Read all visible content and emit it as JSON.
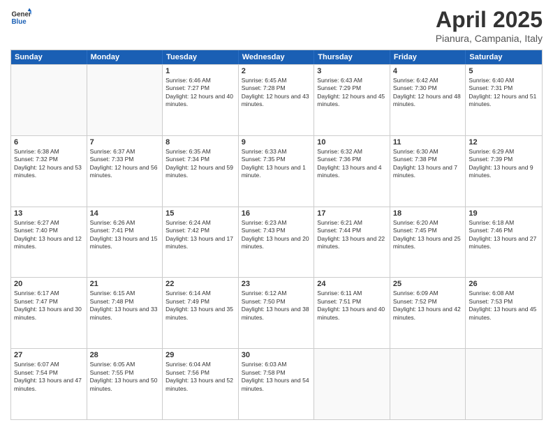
{
  "header": {
    "logo_line1": "General",
    "logo_line2": "Blue",
    "title": "April 2025",
    "subtitle": "Pianura, Campania, Italy"
  },
  "calendar": {
    "days": [
      "Sunday",
      "Monday",
      "Tuesday",
      "Wednesday",
      "Thursday",
      "Friday",
      "Saturday"
    ],
    "rows": [
      [
        {
          "day": "",
          "info": ""
        },
        {
          "day": "",
          "info": ""
        },
        {
          "day": "1",
          "info": "Sunrise: 6:46 AM\nSunset: 7:27 PM\nDaylight: 12 hours and 40 minutes."
        },
        {
          "day": "2",
          "info": "Sunrise: 6:45 AM\nSunset: 7:28 PM\nDaylight: 12 hours and 43 minutes."
        },
        {
          "day": "3",
          "info": "Sunrise: 6:43 AM\nSunset: 7:29 PM\nDaylight: 12 hours and 45 minutes."
        },
        {
          "day": "4",
          "info": "Sunrise: 6:42 AM\nSunset: 7:30 PM\nDaylight: 12 hours and 48 minutes."
        },
        {
          "day": "5",
          "info": "Sunrise: 6:40 AM\nSunset: 7:31 PM\nDaylight: 12 hours and 51 minutes."
        }
      ],
      [
        {
          "day": "6",
          "info": "Sunrise: 6:38 AM\nSunset: 7:32 PM\nDaylight: 12 hours and 53 minutes."
        },
        {
          "day": "7",
          "info": "Sunrise: 6:37 AM\nSunset: 7:33 PM\nDaylight: 12 hours and 56 minutes."
        },
        {
          "day": "8",
          "info": "Sunrise: 6:35 AM\nSunset: 7:34 PM\nDaylight: 12 hours and 59 minutes."
        },
        {
          "day": "9",
          "info": "Sunrise: 6:33 AM\nSunset: 7:35 PM\nDaylight: 13 hours and 1 minute."
        },
        {
          "day": "10",
          "info": "Sunrise: 6:32 AM\nSunset: 7:36 PM\nDaylight: 13 hours and 4 minutes."
        },
        {
          "day": "11",
          "info": "Sunrise: 6:30 AM\nSunset: 7:38 PM\nDaylight: 13 hours and 7 minutes."
        },
        {
          "day": "12",
          "info": "Sunrise: 6:29 AM\nSunset: 7:39 PM\nDaylight: 13 hours and 9 minutes."
        }
      ],
      [
        {
          "day": "13",
          "info": "Sunrise: 6:27 AM\nSunset: 7:40 PM\nDaylight: 13 hours and 12 minutes."
        },
        {
          "day": "14",
          "info": "Sunrise: 6:26 AM\nSunset: 7:41 PM\nDaylight: 13 hours and 15 minutes."
        },
        {
          "day": "15",
          "info": "Sunrise: 6:24 AM\nSunset: 7:42 PM\nDaylight: 13 hours and 17 minutes."
        },
        {
          "day": "16",
          "info": "Sunrise: 6:23 AM\nSunset: 7:43 PM\nDaylight: 13 hours and 20 minutes."
        },
        {
          "day": "17",
          "info": "Sunrise: 6:21 AM\nSunset: 7:44 PM\nDaylight: 13 hours and 22 minutes."
        },
        {
          "day": "18",
          "info": "Sunrise: 6:20 AM\nSunset: 7:45 PM\nDaylight: 13 hours and 25 minutes."
        },
        {
          "day": "19",
          "info": "Sunrise: 6:18 AM\nSunset: 7:46 PM\nDaylight: 13 hours and 27 minutes."
        }
      ],
      [
        {
          "day": "20",
          "info": "Sunrise: 6:17 AM\nSunset: 7:47 PM\nDaylight: 13 hours and 30 minutes."
        },
        {
          "day": "21",
          "info": "Sunrise: 6:15 AM\nSunset: 7:48 PM\nDaylight: 13 hours and 33 minutes."
        },
        {
          "day": "22",
          "info": "Sunrise: 6:14 AM\nSunset: 7:49 PM\nDaylight: 13 hours and 35 minutes."
        },
        {
          "day": "23",
          "info": "Sunrise: 6:12 AM\nSunset: 7:50 PM\nDaylight: 13 hours and 38 minutes."
        },
        {
          "day": "24",
          "info": "Sunrise: 6:11 AM\nSunset: 7:51 PM\nDaylight: 13 hours and 40 minutes."
        },
        {
          "day": "25",
          "info": "Sunrise: 6:09 AM\nSunset: 7:52 PM\nDaylight: 13 hours and 42 minutes."
        },
        {
          "day": "26",
          "info": "Sunrise: 6:08 AM\nSunset: 7:53 PM\nDaylight: 13 hours and 45 minutes."
        }
      ],
      [
        {
          "day": "27",
          "info": "Sunrise: 6:07 AM\nSunset: 7:54 PM\nDaylight: 13 hours and 47 minutes."
        },
        {
          "day": "28",
          "info": "Sunrise: 6:05 AM\nSunset: 7:55 PM\nDaylight: 13 hours and 50 minutes."
        },
        {
          "day": "29",
          "info": "Sunrise: 6:04 AM\nSunset: 7:56 PM\nDaylight: 13 hours and 52 minutes."
        },
        {
          "day": "30",
          "info": "Sunrise: 6:03 AM\nSunset: 7:58 PM\nDaylight: 13 hours and 54 minutes."
        },
        {
          "day": "",
          "info": ""
        },
        {
          "day": "",
          "info": ""
        },
        {
          "day": "",
          "info": ""
        }
      ]
    ]
  }
}
